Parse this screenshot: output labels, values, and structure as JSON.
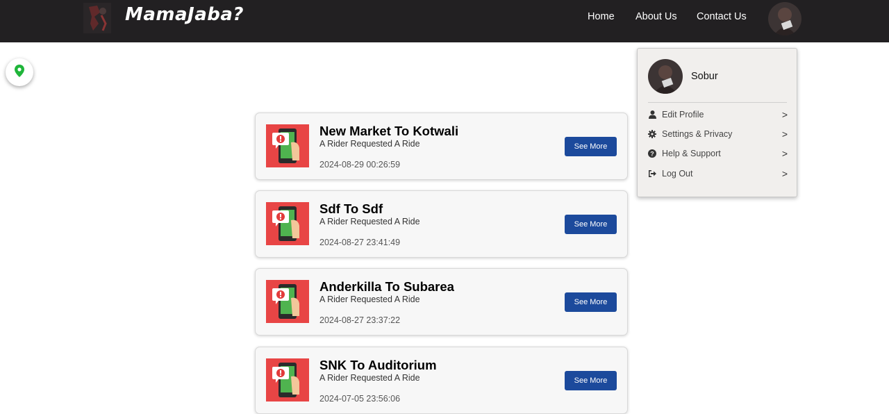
{
  "navbar": {
    "brand": "MamaJaba?",
    "links": [
      "Home",
      "About Us",
      "Contact Us"
    ]
  },
  "notifications": [
    {
      "title": "New Market To Kotwali",
      "subtitle": "A Rider Requested A Ride",
      "date": "2024-08-29 00:26:59",
      "button": "See More"
    },
    {
      "title": "Sdf To Sdf",
      "subtitle": "A Rider Requested A Ride",
      "date": "2024-08-27 23:41:49",
      "button": "See More"
    },
    {
      "title": "Anderkilla To Subarea",
      "subtitle": "A Rider Requested A Ride",
      "date": "2024-08-27 23:37:22",
      "button": "See More"
    },
    {
      "title": "SNK To Auditorium",
      "subtitle": "A Rider Requested A Ride",
      "date": "2024-07-05 23:56:06",
      "button": "See More"
    }
  ],
  "profile_menu": {
    "name": "Sobur",
    "items": [
      {
        "label": "Edit Profile",
        "icon": "user-icon",
        "arrow": ">"
      },
      {
        "label": "Settings & Privacy",
        "icon": "gear-icon",
        "arrow": ">"
      },
      {
        "label": "Help & Support",
        "icon": "question-icon",
        "arrow": ">"
      },
      {
        "label": "Log Out",
        "icon": "logout-icon",
        "arrow": ">"
      }
    ]
  },
  "colors": {
    "navbar": "#222022",
    "button": "#1c4a9c",
    "location_pin": "#1fb53a",
    "alert_red": "#e84545"
  }
}
